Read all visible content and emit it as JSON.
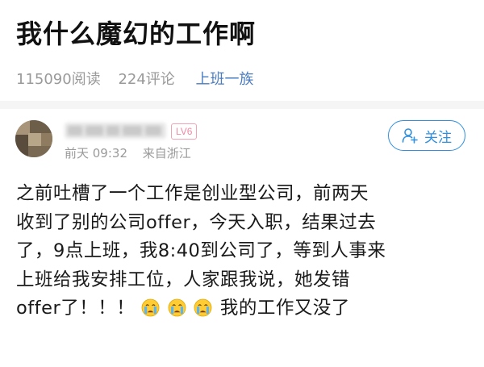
{
  "post": {
    "title": "我什么魔幻的工作啊",
    "views": "115090阅读",
    "comments": "224评论",
    "topic": "上班一族"
  },
  "author": {
    "level": "LV6",
    "time": "前天 09:32",
    "location": "来自浙江",
    "follow_label": "关注"
  },
  "content": {
    "lines": [
      "之前吐槽了一个工作是创业型公司，前两天",
      "收到了别的公司offer，今天入职，结果过去",
      "了，9点上班，我8:40到公司了，等到人事来",
      "上班给我安排工位，人家跟我说，她发错",
      "offer了！！！"
    ],
    "tail": "我的工作又没了",
    "emojis": [
      "crying-face-icon",
      "crying-face-icon",
      "crying-face-icon"
    ]
  },
  "colors": {
    "accent": "#2f8fe0",
    "topic": "#4a7cc0",
    "level_badge": "#ef8aa4",
    "meta_gray": "#9a9a9a"
  }
}
